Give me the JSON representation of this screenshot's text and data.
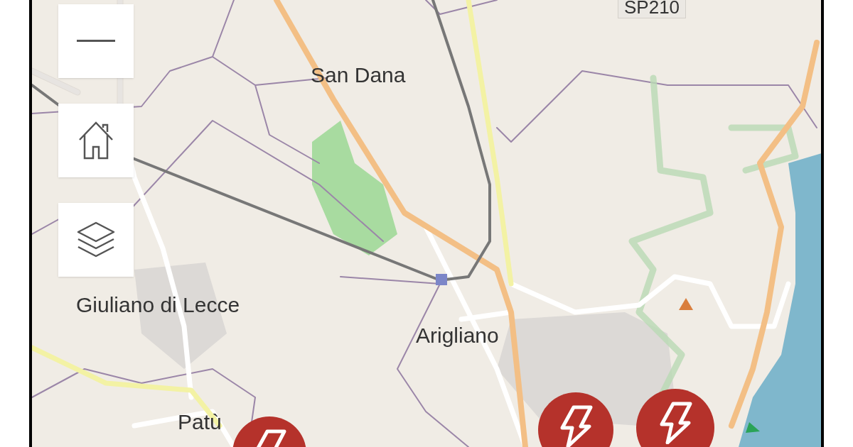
{
  "map": {
    "road_shield": "SP210",
    "place_labels": [
      {
        "text": "San Dana"
      },
      {
        "text": "Giuliano di Lecce"
      },
      {
        "text": "Arigliano"
      },
      {
        "text": "Patù"
      }
    ]
  },
  "controls": [
    {
      "kind": "zoom_out"
    },
    {
      "kind": "home"
    },
    {
      "kind": "layers"
    }
  ]
}
